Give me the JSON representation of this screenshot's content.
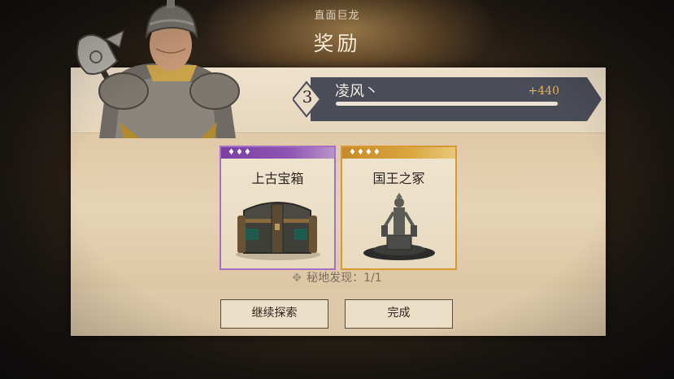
{
  "header": {
    "subtitle": "直面巨龙",
    "title": "奖励"
  },
  "player": {
    "level": "3",
    "name": "凌风丶",
    "exp_gain": "+440",
    "exp_progress": 0.99
  },
  "rewards": [
    {
      "name": "上古宝箱",
      "rarity_diamonds": "♦♦♦",
      "rarity_color": "#8f55b3",
      "icon": "treasure-chest-icon"
    },
    {
      "name": "国王之冢",
      "rarity_diamonds": "♦♦♦♦",
      "rarity_color": "#d9a640",
      "icon": "king-statue-icon"
    }
  ],
  "discovery": {
    "icon": "✥",
    "text": "秘地发现：1/1"
  },
  "buttons": {
    "continue_label": "继续探索",
    "done_label": "完成"
  }
}
